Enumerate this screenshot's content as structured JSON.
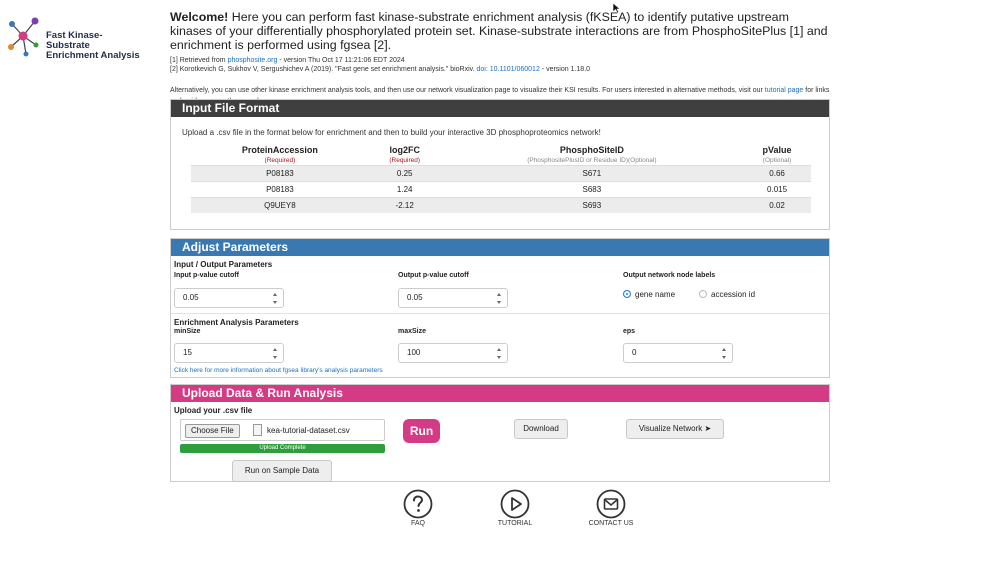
{
  "logo": {
    "line1": "Fast Kinase-Substrate",
    "line2": "Enrichment Analysis",
    "icon": "network-graph-icon"
  },
  "intro": {
    "welcome_bold": "Welcome!",
    "welcome_text": " Here you can perform fast kinase-substrate enrichment analysis (fKSEA) to identify putative upstream kinases of your differentially phosphorylated protein set. Kinase-substrate interactions are from PhosphoSitePlus [1] and enrichment is performed using fgsea [2].",
    "ref1_prefix": "[1] Retrieved from ",
    "ref1_link": "phosphosite.org",
    "ref1_suffix": " - version Thu Oct 17 11:21:06 EDT 2024",
    "ref2_prefix": "[2] Korotkevich G, Sukhov V, Sergushichev A (2019). \"Fast gene set enrichment analysis.\" bioRxiv. ",
    "ref2_link": "doi: 10.1101/060012",
    "ref2_suffix": " - version 1.18.0",
    "alt_text": "Alternatively, you can use other kinase enrichment analysis tools, and then use our network visualization page to visualize their KSI results. For users interested in alternative methods, visit our ",
    "alt_link": "tutorial page",
    "alt_suffix": " for links and guidance on other popular resources."
  },
  "input_format": {
    "title": "Input File Format",
    "description": "Upload a .csv file in the format below for enrichment and then to build your interactive 3D phosphoproteomics network!",
    "columns": [
      {
        "name": "ProteinAccession",
        "note": "(Required)"
      },
      {
        "name": "log2FC",
        "note": "(Required)"
      },
      {
        "name": "PhosphoSiteID",
        "note": "(PhosphositePlusID or Residue ID)(Optional)"
      },
      {
        "name": "pValue",
        "note": "(Optional)"
      }
    ],
    "rows": [
      [
        "P08183",
        "0.25",
        "S671",
        "0.66"
      ],
      [
        "P08183",
        "1.24",
        "S683",
        "0.015"
      ],
      [
        "Q9UEY8",
        "-2.12",
        "S693",
        "0.02"
      ]
    ]
  },
  "params": {
    "title": "Adjust Parameters",
    "io_title": "Input / Output Parameters",
    "input_pval_label": "Input p-value cutoff",
    "input_pval": "0.05",
    "output_pval_label": "Output p-value cutoff",
    "output_pval": "0.05",
    "node_labels_title": "Output network node labels",
    "node_label_gene": "gene name",
    "node_label_accession": "accession id",
    "enrich_title": "Enrichment Analysis Parameters",
    "minsize_label": "minSize",
    "minsize": "15",
    "maxsize_label": "maxSize",
    "maxsize": "100",
    "eps_label": "eps",
    "eps": "0",
    "info_link": "Click here for more information about fgsea library's analysis parameters"
  },
  "upload": {
    "title": "Upload Data & Run Analysis",
    "label": "Upload your .csv file",
    "choose_file": "Choose File",
    "file_name": "kea-tutorial-dataset.csv",
    "progress_text": "Upload Complete",
    "progress": 1.0,
    "run": "Run",
    "download": "Download",
    "visualize": "Visualize Network ➤",
    "sample": "Run on Sample Data"
  },
  "footer": [
    {
      "label": "FAQ",
      "icon": "question-icon"
    },
    {
      "label": "TUTORIAL",
      "icon": "play-icon"
    },
    {
      "label": "CONTACT US",
      "icon": "mail-icon"
    }
  ],
  "colors": {
    "dark_header": "#3f3f3f",
    "blue_header": "#3a78b2",
    "pink_accent": "#d43b84",
    "progress_green": "#2e9e3d",
    "link": "#1a6fc1"
  }
}
